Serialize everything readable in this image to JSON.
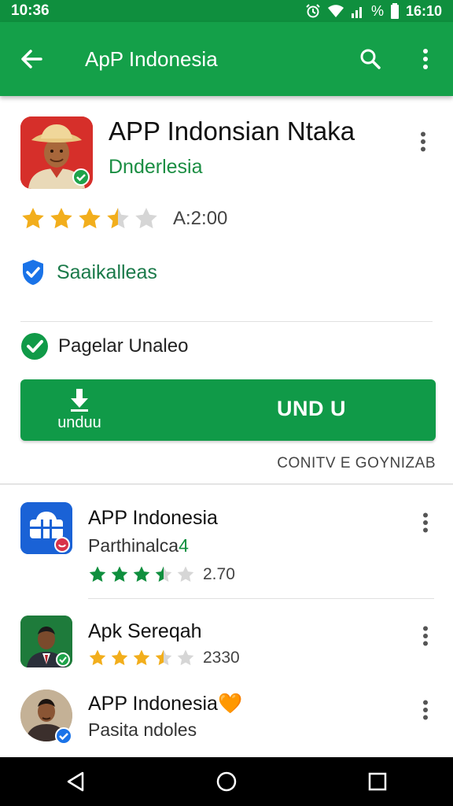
{
  "status_bar": {
    "time": "10:36",
    "battery_time": "16:10",
    "percent_sign": "%",
    "icons": [
      "alarm-icon",
      "wifi-icon",
      "signal-icon",
      "battery-icon"
    ]
  },
  "app_bar": {
    "title": "ApP Indonesia",
    "icons": [
      "back-arrow-icon",
      "search-icon",
      "more-vert-icon"
    ]
  },
  "app_detail": {
    "name": "APP Indonsian Ntaka",
    "developer": "Dnderlesia",
    "rating_value": "A:2:00",
    "rating_stars": 3.5,
    "badge_label": "Saaikalleas",
    "verified_label": "Pagelar Unaleo",
    "install_button": {
      "left_label": "unduu",
      "label": "UND U"
    },
    "contribute_label": "CONITV E GOYNIZAB"
  },
  "list": [
    {
      "title": "APP Indonesia",
      "subtitle": "Parthinalca",
      "subtitle_accent": "4",
      "rating_value": "2.70",
      "rating_stars": 3.5,
      "star_color": "#0f8f3e"
    },
    {
      "title": "Apk Sereqah",
      "subtitle": "",
      "rating_value": "2330",
      "rating_stars": 3.5,
      "star_color": "#f2ae1c"
    },
    {
      "title": "APP Indonesia",
      "title_emoji": "🧡",
      "subtitle": "Pasita ndoles",
      "rating_value": "",
      "rating_stars": 0,
      "star_color": "#f2ae1c"
    }
  ],
  "colors": {
    "primary": "#14a049",
    "primary_dark": "#0f8f3e",
    "star_gold": "#f2ae1c",
    "badge_blue": "#1a73e8"
  }
}
